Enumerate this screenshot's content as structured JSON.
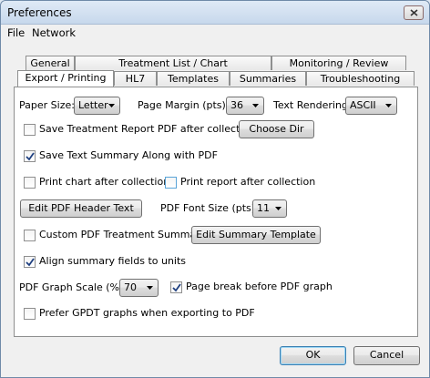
{
  "window": {
    "title": "Preferences"
  },
  "menu": {
    "file": "File",
    "network": "Network"
  },
  "tabs": {
    "general": "General",
    "treatment": "Treatment List / Chart",
    "monitoring": "Monitoring / Review",
    "export": "Export / Printing",
    "hl7": "HL7",
    "templates": "Templates",
    "summaries": "Summaries",
    "troubleshooting": "Troubleshooting"
  },
  "export": {
    "paper_size_label": "Paper Size:",
    "paper_size": "Letter",
    "page_margin_label": "Page Margin (pts):",
    "page_margin": "36",
    "text_rendering_label": "Text Rendering",
    "text_rendering": "ASCII",
    "save_treatment_pdf": {
      "label": "Save Treatment Report PDF after collection",
      "checked": false
    },
    "choose_dir": "Choose Dir",
    "save_text_summary": {
      "label": "Save Text Summary Along with PDF",
      "checked": true
    },
    "print_chart": {
      "label": "Print chart after collection",
      "checked": false
    },
    "print_report": {
      "label": "Print report after collection",
      "checked": false
    },
    "edit_pdf_header": "Edit PDF Header Text",
    "pdf_font_size_label": "PDF Font Size (pts):",
    "pdf_font_size": "11",
    "custom_pdf_summary": {
      "label": "Custom PDF Treatment Summary",
      "checked": false
    },
    "edit_summary_template": "Edit Summary Template",
    "align_summary": {
      "label": "Align summary fields to units",
      "checked": true
    },
    "graph_scale_label": "PDF Graph Scale (%):",
    "graph_scale": "70",
    "page_break": {
      "label": "Page break before PDF graph",
      "checked": true
    },
    "prefer_gpdt": {
      "label": "Prefer GPDT graphs when exporting to PDF",
      "checked": false
    }
  },
  "buttons": {
    "ok": "OK",
    "cancel": "Cancel"
  }
}
